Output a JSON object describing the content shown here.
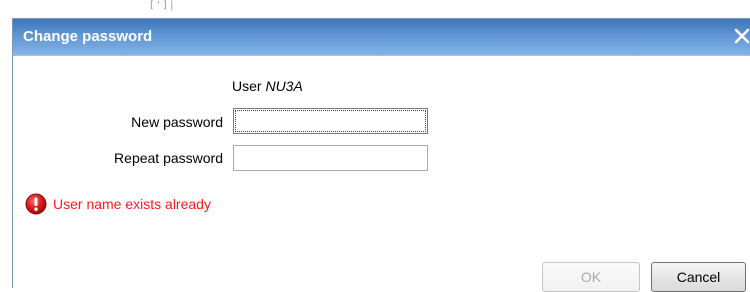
{
  "backdrop": {
    "fragment_text": "[ ' ] |"
  },
  "dialog": {
    "title": "Change password",
    "close_icon": "close-icon",
    "user_prefix": "User",
    "user_name": "NU3A",
    "new_password": {
      "label": "New password",
      "value": ""
    },
    "repeat_password": {
      "label": "Repeat password",
      "value": ""
    },
    "error": {
      "icon": "error-icon",
      "message": "User name exists already",
      "color": "#ff1a1a"
    },
    "buttons": {
      "ok_label": "OK",
      "ok_enabled": false,
      "cancel_label": "Cancel"
    }
  },
  "colors": {
    "titlebar_top": "#3f73b9",
    "titlebar_bottom": "#84b3e6",
    "error_red": "#ff1a1a"
  }
}
